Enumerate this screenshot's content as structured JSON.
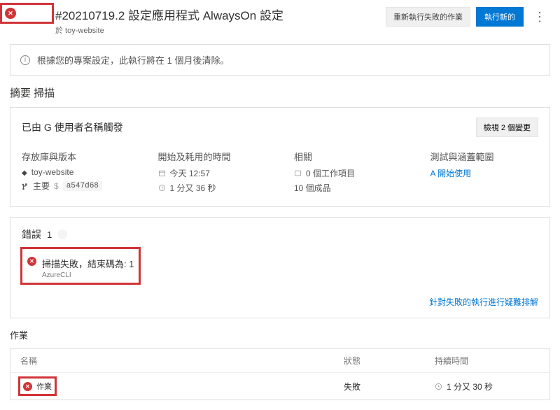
{
  "header": {
    "title": "#20210719.2 設定應用程式 AlwaysOn 設定",
    "subtitle": "於 toy-website",
    "rerun_btn": "重新執行失敗的作業",
    "run_new_btn": "執行新的"
  },
  "banner": {
    "text": "根據您的專案設定，此執行將在 1 個月後清除。"
  },
  "section_title": "摘要 掃描",
  "summary": {
    "trigger_text": "已由 G 使用者名稱觸發",
    "view_changes": "檢視 2 個變更",
    "repo_label": "存放庫與版本",
    "repo": "toy-website",
    "branch": "主要",
    "commit": "a547d68",
    "time_label": "開始及耗用的時間",
    "start": "今天 12:57",
    "duration": "1 分又 36 秒",
    "related_label": "相關",
    "workitems": "0 個工作項目",
    "artifacts": "10 個成品",
    "tests_label": "測試與涵蓋範圍",
    "get_started": "A 開始使用"
  },
  "errors": {
    "label": "錯誤",
    "count": "1",
    "msg": "掃描失敗，結束碼為: 1",
    "source": "AzureCLI",
    "troubleshoot": "針對失敗的執行進行疑難排解"
  },
  "jobs": {
    "title": "作業",
    "col_name": "名稱",
    "col_status": "狀態",
    "col_duration": "持續時間",
    "row": {
      "name": "作業",
      "status": "失敗",
      "duration": "1 分又 30 秒"
    }
  }
}
